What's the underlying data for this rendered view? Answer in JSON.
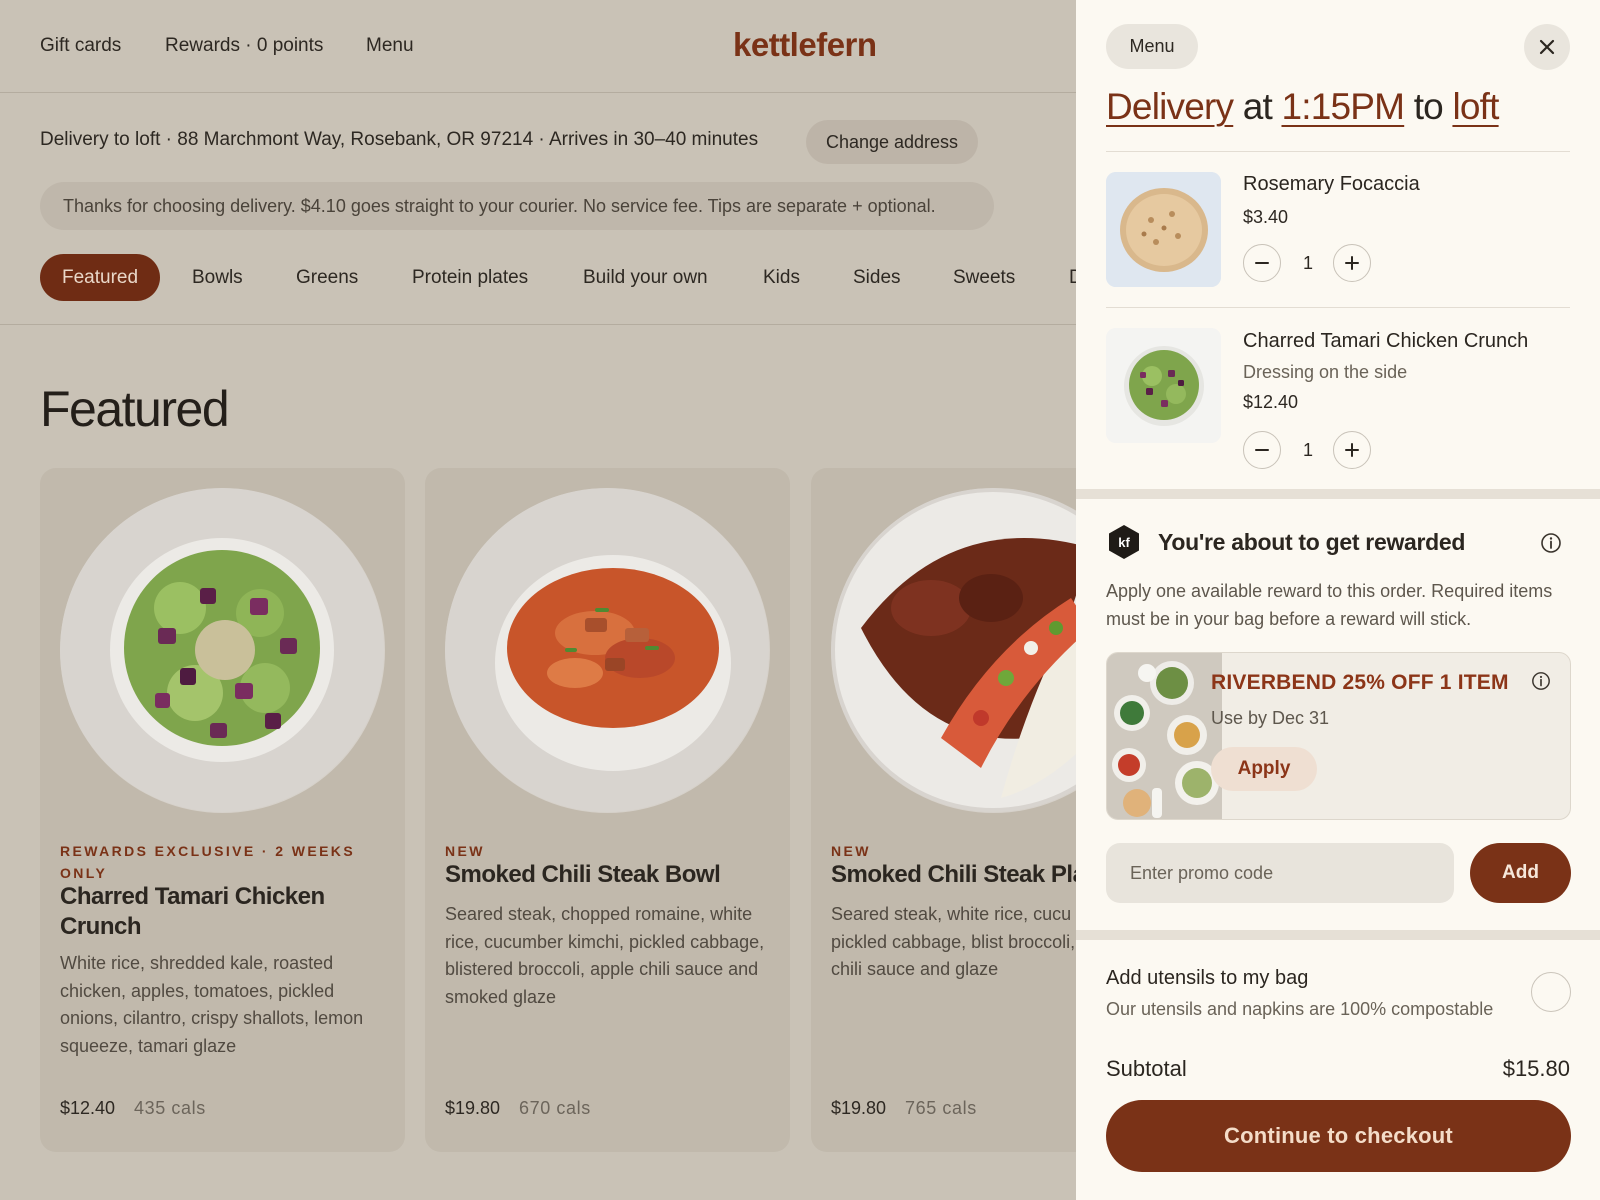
{
  "top_nav": {
    "gift_cards": "Gift cards",
    "rewards": "Rewards · 0 points",
    "menu": "Menu",
    "logo": "kettlefern"
  },
  "delivery_bar": {
    "text": "Delivery to loft · 88 Marchmont Way, Rosebank, OR 97214 · Arrives in 30–40 minutes",
    "change_button": "Change address"
  },
  "notice": "Thanks for choosing delivery. $4.10 goes straight to your courier. No service fee. Tips are separate + optional.",
  "categories": [
    "Featured",
    "Bowls",
    "Greens",
    "Protein plates",
    "Build your own",
    "Kids",
    "Sides",
    "Sweets",
    "D"
  ],
  "active_category": "Featured",
  "section_title": "Featured",
  "products": [
    {
      "tag": "REWARDS EXCLUSIVE · 2 WEEKS ONLY",
      "name": "Charred Tamari Chicken Crunch",
      "description": "White rice, shredded kale, roasted chicken, apples, tomatoes, pickled onions, cilantro, crispy shallots, lemon squeeze, tamari glaze",
      "price": "$12.40",
      "calories": "435 cals",
      "image_icon": "salad-bowl-image"
    },
    {
      "tag": "NEW",
      "name": "Smoked Chili Steak Bowl",
      "description": "Seared steak, chopped romaine, white rice, cucumber kimchi, pickled cabbage, blistered broccoli, apple chili sauce and smoked glaze",
      "price": "$19.80",
      "calories": "670 cals",
      "image_icon": "rice-bowl-image"
    },
    {
      "tag": "NEW",
      "name": "Smoked Chili Steak Pla",
      "description": "Seared steak, white rice, cucu kimchi, pickled cabbage, blist broccoli, apple chili sauce and glaze",
      "price": "$19.80",
      "calories": "765 cals",
      "image_icon": "beans-rice-plate-image"
    }
  ],
  "cart": {
    "menu_button": "Menu",
    "close_icon": "close-icon",
    "heading": {
      "mode": "Delivery",
      "at": "at",
      "time": "1:15PM",
      "to": "to",
      "place": "loft"
    },
    "items": [
      {
        "name": "Rosemary Focaccia",
        "modifier": "",
        "price": "$3.40",
        "quantity": "1",
        "image_icon": "focaccia-image"
      },
      {
        "name": "Charred Tamari Chicken Crunch",
        "modifier": "Dressing on the side",
        "price": "$12.40",
        "quantity": "1",
        "image_icon": "salad-bowl-image"
      }
    ],
    "rewards": {
      "badge": "kf",
      "title": "You're about to get rewarded",
      "description": "Apply one available reward to this order. Required items must be in your bag before a reward will stick.",
      "offer": {
        "code": "RIVERBEND 25% OFF 1 ITEM",
        "expiry": "Use by Dec 31",
        "apply_button": "Apply",
        "image_icon": "table-spread-image"
      }
    },
    "promo": {
      "placeholder": "Enter promo code",
      "add_button": "Add"
    },
    "utensils": {
      "label": "Add utensils to my bag",
      "sub": "Our utensils and napkins are 100% compostable",
      "checked": false
    },
    "subtotal_label": "Subtotal",
    "subtotal_value": "$15.80",
    "checkout_button": "Continue to checkout"
  },
  "colors": {
    "brand": "#7a3217",
    "page_background": "#c9c2b6",
    "panel_background": "#fcf9f2"
  }
}
